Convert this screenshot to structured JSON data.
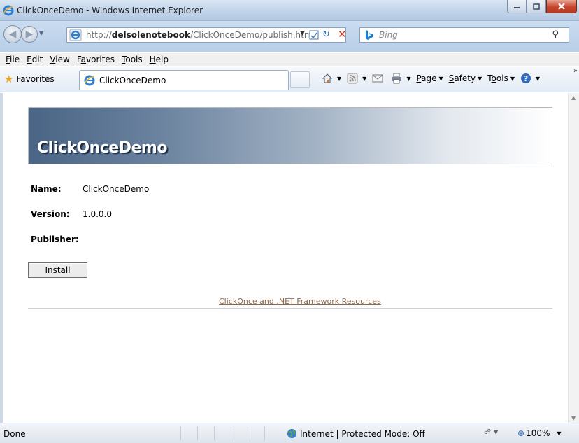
{
  "window": {
    "title": "ClickOnceDemo - Windows Internet Explorer"
  },
  "address_bar": {
    "url_prefix": "http://",
    "url_host": "delsolenotebook",
    "url_path": "/ClickOnceDemo/publish.htm",
    "search_placeholder": "Bing"
  },
  "menu": {
    "items": [
      {
        "label": "File",
        "key": "F",
        "rest": "ile"
      },
      {
        "label": "Edit",
        "key": "E",
        "rest": "dit"
      },
      {
        "label": "View",
        "key": "V",
        "rest": "iew"
      },
      {
        "label": "Favorites",
        "key": "a",
        "pre": "F",
        "rest": "vorites"
      },
      {
        "label": "Tools",
        "key": "T",
        "rest": "ools"
      },
      {
        "label": "Help",
        "key": "H",
        "rest": "elp"
      }
    ]
  },
  "favorites_bar": {
    "favorites_label": "Favorites",
    "tab_title": "ClickOnceDemo"
  },
  "command_bar": {
    "page": "Page",
    "safety": "Safety",
    "tools": "Tools"
  },
  "page": {
    "heading": "ClickOnceDemo",
    "name_label": "Name:",
    "name_value": "ClickOnceDemo",
    "version_label": "Version:",
    "version_value": "1.0.0.0",
    "publisher_label": "Publisher:",
    "publisher_value": "",
    "install_button": "Install",
    "resources_link": "ClickOnce and .NET Framework Resources"
  },
  "status_bar": {
    "status": "Done",
    "zone": "Internet | Protected Mode: Off",
    "zoom": "100%"
  },
  "colors": {
    "banner_dark": "#4a6485",
    "link": "#8b6a4a",
    "close_button": "#c8462d"
  },
  "icons": [
    "ie-icon",
    "back-icon",
    "forward-icon",
    "refresh-icon",
    "stop-icon",
    "compat-view-icon",
    "bing-icon",
    "search-icon",
    "favorites-star-icon",
    "home-icon",
    "feeds-icon",
    "mail-icon",
    "print-icon",
    "help-icon",
    "globe-icon",
    "protected-mode-icon",
    "zoom-icon"
  ]
}
